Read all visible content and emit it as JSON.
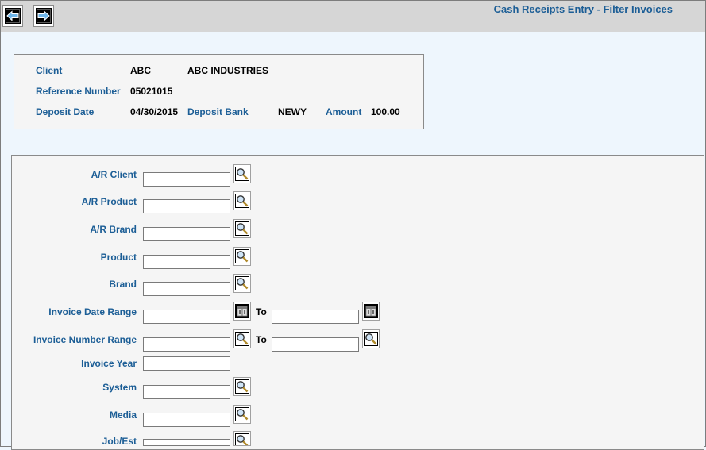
{
  "window": {
    "title": "Cash Receipts Entry - Filter Invoices"
  },
  "nav": {
    "back_icon": "arrow-left-icon",
    "forward_icon": "arrow-right-icon"
  },
  "header": {
    "client_label": "Client",
    "client_code": "ABC",
    "client_name": "ABC INDUSTRIES",
    "reference_label": "Reference Number",
    "reference_value": "05021015",
    "deposit_date_label": "Deposit Date",
    "deposit_date_value": "04/30/2015",
    "deposit_bank_label": "Deposit Bank",
    "deposit_bank_value": "NEWY",
    "amount_label": "Amount",
    "amount_value": "100.00"
  },
  "filters": {
    "ar_client_label": "A/R Client",
    "ar_product_label": "A/R Product",
    "ar_brand_label": "A/R Brand",
    "product_label": "Product",
    "brand_label": "Brand",
    "invoice_date_range_label": "Invoice Date Range",
    "invoice_number_range_label": "Invoice Number Range",
    "invoice_year_label": "Invoice Year",
    "system_label": "System",
    "media_label": "Media",
    "job_est_label": "Job/Est",
    "to_label": "To",
    "values": {
      "ar_client": "",
      "ar_product": "",
      "ar_brand": "",
      "product": "",
      "brand": "",
      "invoice_date_from": "",
      "invoice_date_to": "",
      "invoice_number_from": "",
      "invoice_number_to": "",
      "invoice_year": "",
      "system": "",
      "media": "",
      "job_est": ""
    },
    "lookup_icon": "magnifier-icon",
    "calendar_icon": "calendar-icon"
  },
  "colors": {
    "label": "#1c5e96",
    "background": "#eef6fd",
    "topbar": "#d6d6d6",
    "panel": "#f5f5f5"
  }
}
